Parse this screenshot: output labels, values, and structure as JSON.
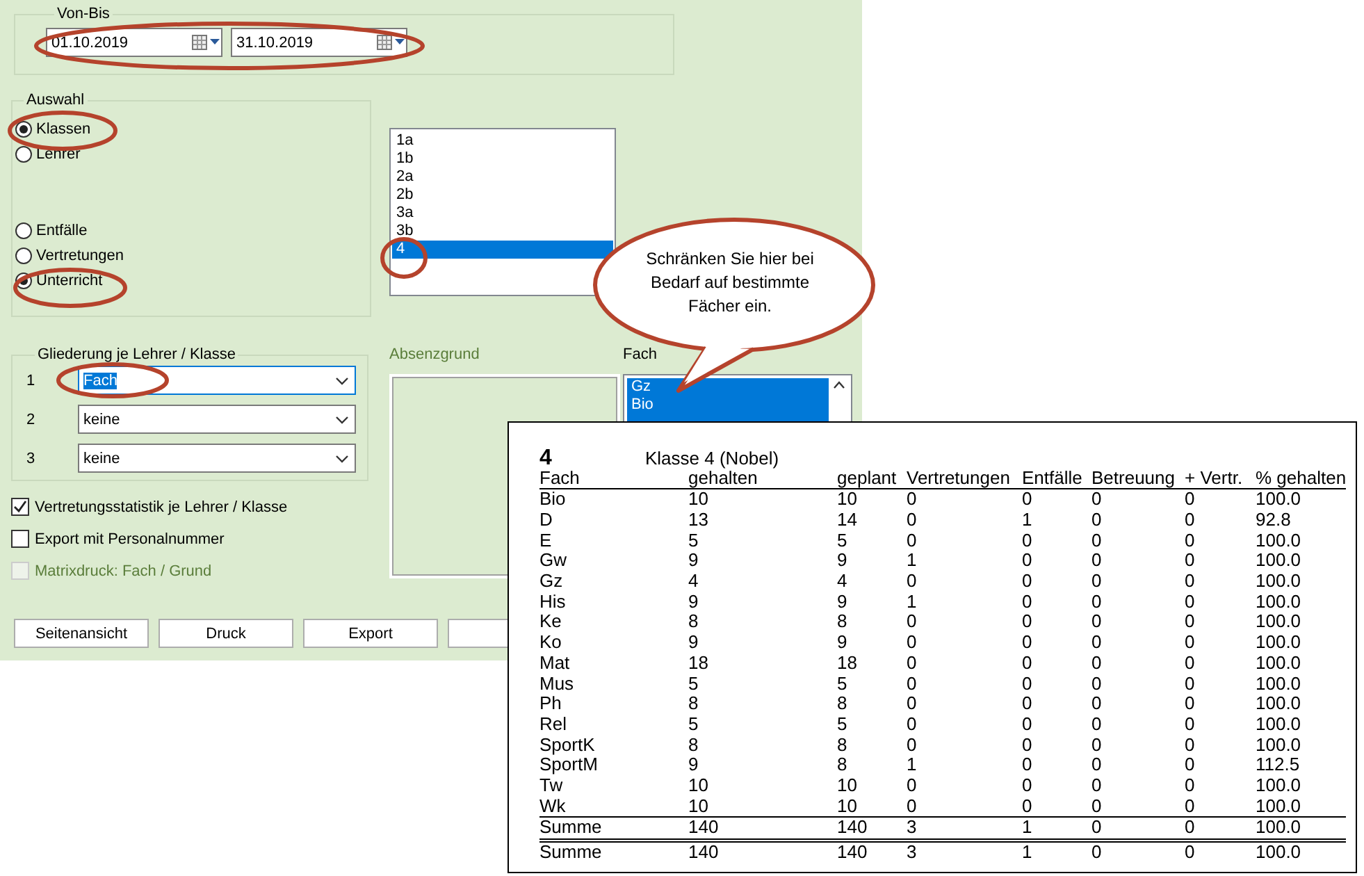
{
  "date_range": {
    "label": "Von-Bis",
    "from": "01.10.2019",
    "to": "31.10.2019"
  },
  "selection": {
    "label": "Auswahl",
    "scope_options": [
      {
        "label": "Klassen",
        "selected": true
      },
      {
        "label": "Lehrer",
        "selected": false
      }
    ],
    "type_options": [
      {
        "label": "Entfälle",
        "selected": false
      },
      {
        "label": "Vertretungen",
        "selected": false
      },
      {
        "label": "Unterricht",
        "selected": true
      }
    ]
  },
  "class_list": {
    "items": [
      {
        "label": "1a",
        "selected": false
      },
      {
        "label": "1b",
        "selected": false
      },
      {
        "label": "2a",
        "selected": false
      },
      {
        "label": "2b",
        "selected": false
      },
      {
        "label": "3a",
        "selected": false
      },
      {
        "label": "3b",
        "selected": false
      },
      {
        "label": "4",
        "selected": true
      }
    ]
  },
  "breakdown": {
    "label": "Gliederung je Lehrer / Klasse",
    "levels": [
      {
        "number": "1",
        "value": "Fach",
        "focused": true
      },
      {
        "number": "2",
        "value": "keine",
        "focused": false
      },
      {
        "number": "3",
        "value": "keine",
        "focused": false
      }
    ]
  },
  "options": [
    {
      "label": "Vertretungsstatistik je Lehrer / Klasse",
      "checked": true,
      "disabled": false
    },
    {
      "label": "Export mit Personalnummer",
      "checked": false,
      "disabled": false
    },
    {
      "label": "Matrixdruck: Fach / Grund",
      "checked": false,
      "disabled": true
    }
  ],
  "absence_reason": {
    "label": "Absenzgrund",
    "disabled": true
  },
  "subject": {
    "label": "Fach",
    "items": [
      {
        "label": "Gz",
        "selected": true
      },
      {
        "label": "Bio",
        "selected": true
      }
    ]
  },
  "buttons": [
    "Seitenansicht",
    "Druck",
    "Export"
  ],
  "callout": {
    "text": "Schränken Sie hier bei Bedarf auf bestimmte Fächer ein."
  },
  "report": {
    "class": "4",
    "title": "Klasse 4 (Nobel)",
    "columns": [
      "Fach",
      "gehalten",
      "geplant",
      "Vertretungen",
      "Entfälle",
      "Betreuung",
      "+ Vertr.",
      "% gehalten"
    ],
    "rows": [
      [
        "Bio",
        "10",
        "10",
        "0",
        "0",
        "0",
        "0",
        "100.0"
      ],
      [
        "D",
        "13",
        "14",
        "0",
        "1",
        "0",
        "0",
        "92.8"
      ],
      [
        "E",
        "5",
        "5",
        "0",
        "0",
        "0",
        "0",
        "100.0"
      ],
      [
        "Gw",
        "9",
        "9",
        "1",
        "0",
        "0",
        "0",
        "100.0"
      ],
      [
        "Gz",
        "4",
        "4",
        "0",
        "0",
        "0",
        "0",
        "100.0"
      ],
      [
        "His",
        "9",
        "9",
        "1",
        "0",
        "0",
        "0",
        "100.0"
      ],
      [
        "Ke",
        "8",
        "8",
        "0",
        "0",
        "0",
        "0",
        "100.0"
      ],
      [
        "Ko",
        "9",
        "9",
        "0",
        "0",
        "0",
        "0",
        "100.0"
      ],
      [
        "Mat",
        "18",
        "18",
        "0",
        "0",
        "0",
        "0",
        "100.0"
      ],
      [
        "Mus",
        "5",
        "5",
        "0",
        "0",
        "0",
        "0",
        "100.0"
      ],
      [
        "Ph",
        "8",
        "8",
        "0",
        "0",
        "0",
        "0",
        "100.0"
      ],
      [
        "Rel",
        "5",
        "5",
        "0",
        "0",
        "0",
        "0",
        "100.0"
      ],
      [
        "SportK",
        "8",
        "8",
        "0",
        "0",
        "0",
        "0",
        "100.0"
      ],
      [
        "SportM",
        "9",
        "8",
        "1",
        "0",
        "0",
        "0",
        "112.5"
      ],
      [
        "Tw",
        "10",
        "10",
        "0",
        "0",
        "0",
        "0",
        "100.0"
      ],
      [
        "Wk",
        "10",
        "10",
        "0",
        "0",
        "0",
        "0",
        "100.0"
      ]
    ],
    "totals": [
      [
        "Summe",
        "140",
        "140",
        "3",
        "1",
        "0",
        "0",
        "100.0"
      ],
      [
        "Summe",
        "140",
        "140",
        "3",
        "1",
        "0",
        "0",
        "100.0"
      ]
    ]
  }
}
